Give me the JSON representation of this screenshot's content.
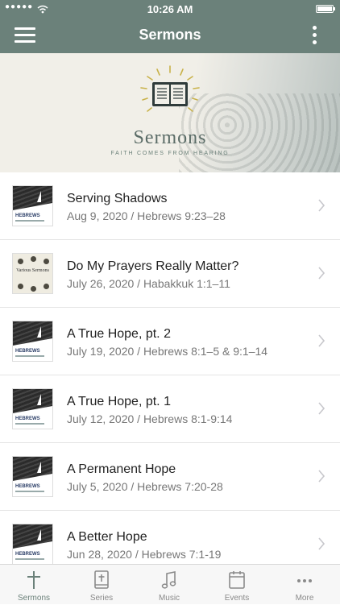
{
  "status_bar": {
    "time": "10:26 AM",
    "signal": "●●●●●"
  },
  "header": {
    "title": "Sermons"
  },
  "banner": {
    "title": "Sermons",
    "subtitle": "FAITH COMES FROM HEARING"
  },
  "sermons": [
    {
      "title": "Serving Shadows",
      "subtitle": "Aug 9, 2020 / Hebrews 9:23–28",
      "thumb": "hebrews",
      "thumb_label": "HEBREWS"
    },
    {
      "title": "Do My Prayers Really Matter?",
      "subtitle": "July 26, 2020 / Habakkuk 1:1–11",
      "thumb": "various",
      "thumb_label": "Various Sermons"
    },
    {
      "title": "A True Hope, pt. 2",
      "subtitle": "July 19, 2020 / Hebrews 8:1–5 & 9:1–14",
      "thumb": "hebrews",
      "thumb_label": "HEBREWS"
    },
    {
      "title": "A True Hope, pt. 1",
      "subtitle": "July 12, 2020 / Hebrews 8:1-9:14",
      "thumb": "hebrews",
      "thumb_label": "HEBREWS"
    },
    {
      "title": "A Permanent Hope",
      "subtitle": "July 5, 2020 / Hebrews 7:20-28",
      "thumb": "hebrews",
      "thumb_label": "HEBREWS"
    },
    {
      "title": "A Better Hope",
      "subtitle": "Jun 28, 2020 / Hebrews 7:1-19",
      "thumb": "hebrews",
      "thumb_label": "HEBREWS"
    }
  ],
  "tabs": [
    {
      "label": "Sermons",
      "icon": "cross-icon",
      "active": true
    },
    {
      "label": "Series",
      "icon": "bible-icon",
      "active": false
    },
    {
      "label": "Music",
      "icon": "music-note-icon",
      "active": false
    },
    {
      "label": "Events",
      "icon": "calendar-icon",
      "active": false
    },
    {
      "label": "More",
      "icon": "ellipsis-icon",
      "active": false
    }
  ],
  "colors": {
    "accent": "#6b817a",
    "tab_inactive": "#8a8a8a",
    "banner_text": "#5b6c67"
  }
}
